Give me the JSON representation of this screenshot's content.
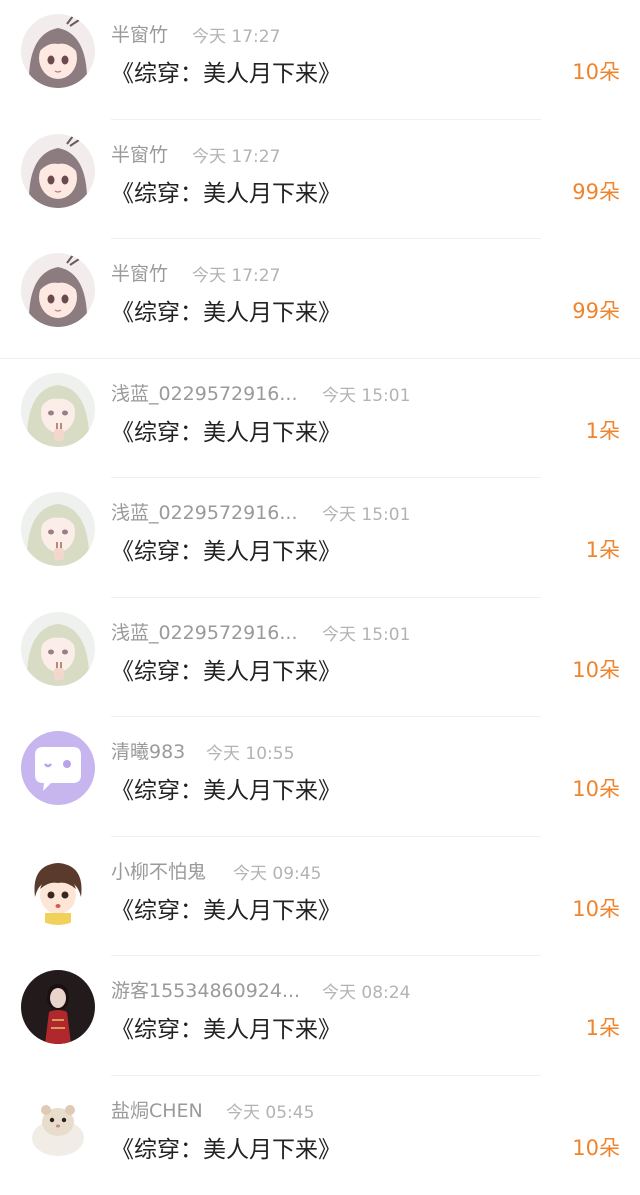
{
  "comments": [
    {
      "name": "半窗竹",
      "time": "今天 17:27",
      "book": "《综穿：美人月下来》",
      "count": "10朵",
      "avatar": "girl-grey-hair-avatar"
    },
    {
      "name": "半窗竹",
      "time": "今天 17:27",
      "book": "《综穿：美人月下来》",
      "count": "99朵",
      "avatar": "girl-grey-hair-avatar"
    },
    {
      "name": "半窗竹",
      "time": "今天 17:27",
      "book": "《综穿：美人月下来》",
      "count": "99朵",
      "avatar": "girl-grey-hair-avatar"
    },
    {
      "name": "浅蓝_0229572916...",
      "time": "今天 15:01",
      "book": "《综穿：美人月下来》",
      "count": "1朵",
      "avatar": "girl-blonde-avatar"
    },
    {
      "name": "浅蓝_0229572916...",
      "time": "今天 15:01",
      "book": "《综穿：美人月下来》",
      "count": "1朵",
      "avatar": "girl-blonde-avatar"
    },
    {
      "name": "浅蓝_0229572916...",
      "time": "今天 15:01",
      "book": "《综穿：美人月下来》",
      "count": "10朵",
      "avatar": "girl-blonde-avatar"
    },
    {
      "name": "清曦983",
      "time": "今天 10:55",
      "book": "《综穿：美人月下来》",
      "count": "10朵",
      "avatar": "chat-bubble-avatar"
    },
    {
      "name": "小柳不怕鬼",
      "time": "今天 09:45",
      "book": "《综穿：美人月下来》",
      "count": "10朵",
      "avatar": "cartoon-girl-avatar"
    },
    {
      "name": "游客15534860924...",
      "time": "今天 08:24",
      "book": "《综穿：美人月下来》",
      "count": "1朵",
      "avatar": "woman-red-dress-avatar"
    },
    {
      "name": "盐焗CHEN",
      "time": "今天 05:45",
      "book": "《综穿：美人月下来》",
      "count": "10朵",
      "avatar": "hamster-avatar"
    }
  ],
  "colors": {
    "count": "#f0842c",
    "name": "#9a9a9a",
    "time": "#b3b3b3",
    "book": "#222222",
    "divider": "#efefef"
  }
}
